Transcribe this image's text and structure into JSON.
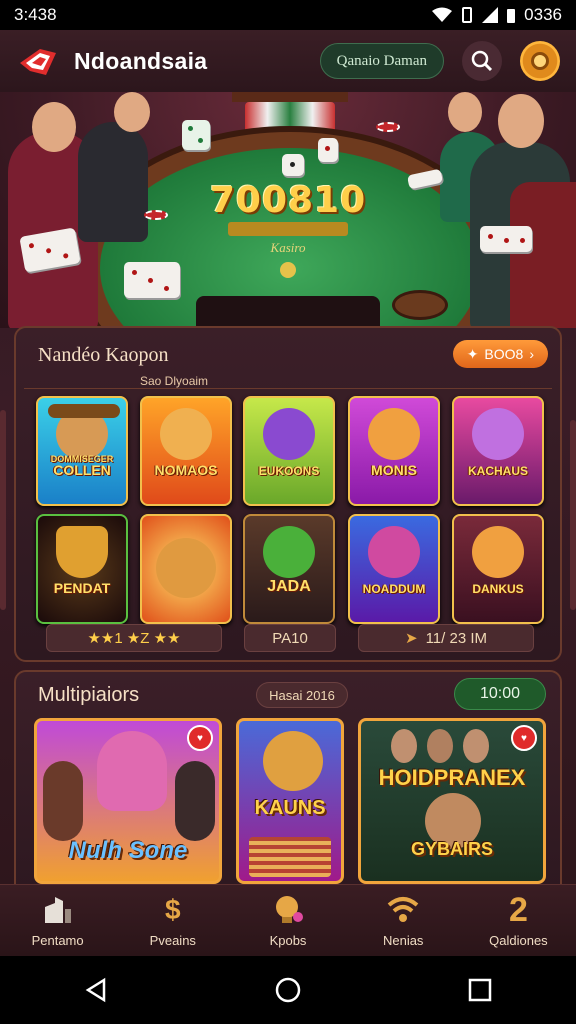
{
  "status_bar": {
    "time": "3:438",
    "right_text": "0336"
  },
  "app": {
    "brand": "Ndoandsaia",
    "header_button": "Qanaio Daman",
    "colors": {
      "accent": "#e0661a",
      "felt": "#1f7a3a",
      "gold": "#ffcf4a"
    }
  },
  "hero": {
    "jackpot": "700810",
    "felt_label": "Kasiro"
  },
  "section1": {
    "title": "Nandéo Kaopon",
    "tag": "BOO8",
    "subheader": "Sao Dlyoaim",
    "games": [
      {
        "label": "COLLEN",
        "top": "DOMMISEGER"
      },
      {
        "label": "NOMAOS"
      },
      {
        "label": "EUKOONS"
      },
      {
        "label": "MONIS"
      },
      {
        "label": "KACHAUS"
      },
      {
        "label": "PENDAT"
      },
      {
        "label": ""
      },
      {
        "label": "JADA"
      },
      {
        "label": "NOADDUM"
      },
      {
        "label": "DANKUS"
      }
    ],
    "rating": "★★1 ★Z ★★",
    "count": "PA10",
    "time": "11/ 23 IM"
  },
  "section2": {
    "title": "Multipiaiors",
    "date": "Hasai 2016",
    "time": "10:00",
    "cards": [
      {
        "label": "Nulh Sone"
      },
      {
        "label": "KAUNS"
      },
      {
        "label": "HOIDPRANEX",
        "sub": "GYBAIRS"
      }
    ]
  },
  "nav": [
    {
      "label": "Pentamo",
      "icon": "home-icon"
    },
    {
      "label": "Pveains",
      "icon": "dollar-icon"
    },
    {
      "label": "Kpobs",
      "icon": "bulb-icon"
    },
    {
      "label": "Nenias",
      "icon": "wifi-icon"
    },
    {
      "label": "Qaldiones",
      "icon": "number-two-icon",
      "glyph": "2"
    }
  ]
}
